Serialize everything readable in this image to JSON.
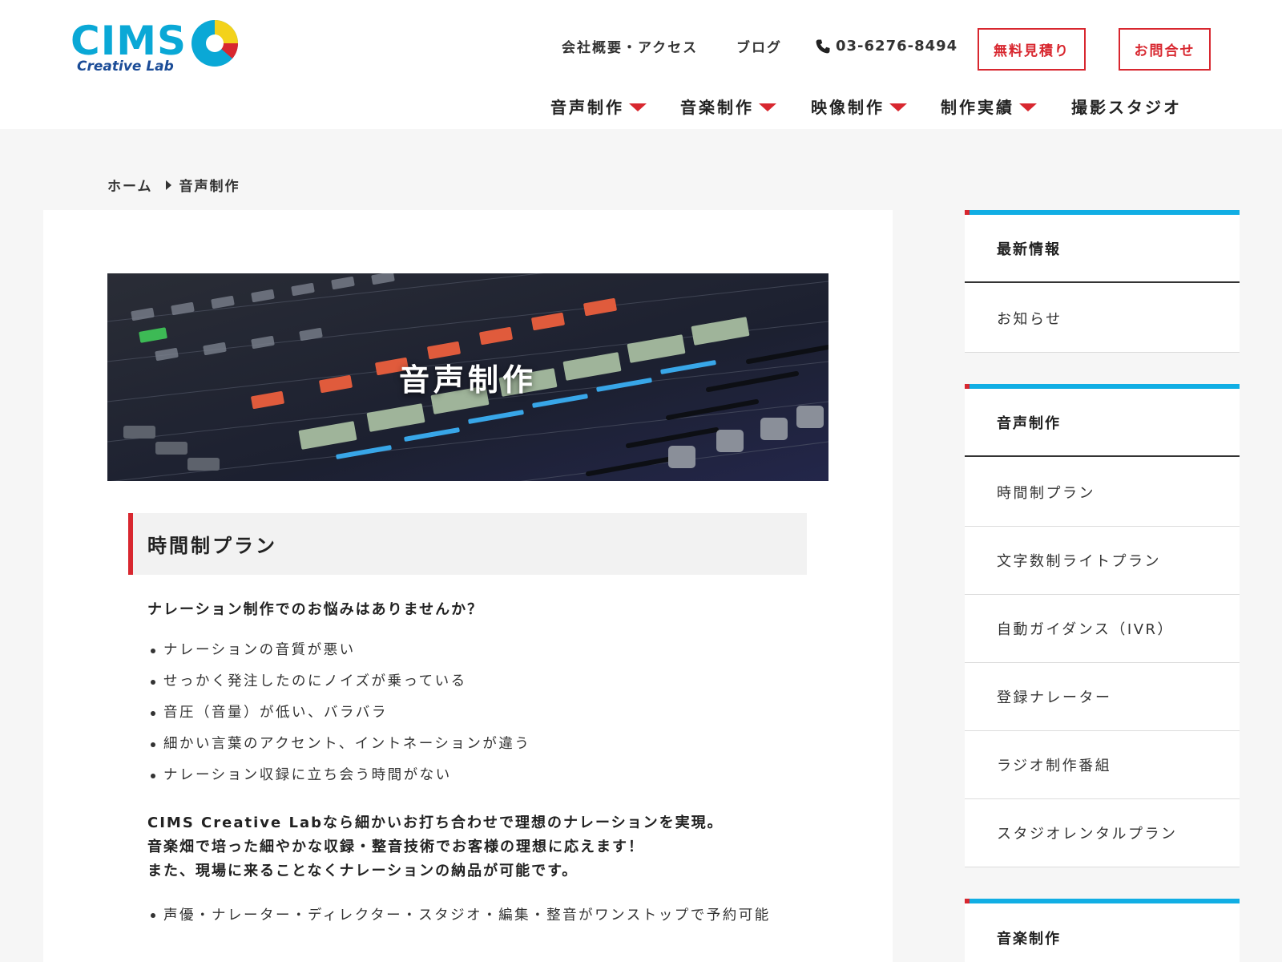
{
  "header": {
    "logo": {
      "main": "CIMS",
      "sub": "Creative Lab"
    },
    "utility_nav": {
      "company": "会社概要・アクセス",
      "blog": "ブログ",
      "phone": "03-6276-8494",
      "estimate_button": "無料見積り",
      "contact_button": "お問合せ"
    },
    "main_nav": [
      {
        "label": "音声制作",
        "has_dropdown": true
      },
      {
        "label": "音楽制作",
        "has_dropdown": true
      },
      {
        "label": "映像制作",
        "has_dropdown": true
      },
      {
        "label": "制作実績",
        "has_dropdown": true
      },
      {
        "label": "撮影スタジオ",
        "has_dropdown": false
      }
    ]
  },
  "breadcrumb": {
    "home": "ホーム",
    "current": "音声制作"
  },
  "main": {
    "hero_title": "音声制作",
    "section_title": "時間制プラン",
    "lead": "ナレーション制作でのお悩みはありませんか？",
    "concerns": [
      "ナレーションの音質が悪い",
      "せっかく発注したのにノイズが乗っている",
      "音圧（音量）が低い、バラバラ",
      "細かい言葉のアクセント、イントネーションが違う",
      "ナレーション収録に立ち会う時間がない"
    ],
    "paragraph": [
      "CIMS Creative Labなら細かいお打ち合わせで理想のナレーションを実現。",
      "音楽畑で培った細やかな収録・整音技術でお客様の理想に応えます！",
      "また、現場に来ることなくナレーションの納品が可能です。"
    ],
    "features": [
      "声優・ナレーター・ディレクター・スタジオ・編集・整音がワンストップで予約可能"
    ]
  },
  "sidebar": {
    "news": {
      "title": "最新情報",
      "items": [
        "お知らせ"
      ]
    },
    "voice": {
      "title": "音声制作",
      "items": [
        "時間制プラン",
        "文字数制ライトプラン",
        "自動ガイダンス（IVR）",
        "登録ナレーター",
        "ラジオ制作番組",
        "スタジオレンタルプラン"
      ]
    },
    "music": {
      "title": "音楽制作"
    }
  },
  "colors": {
    "accent_red": "#d8272f",
    "accent_blue": "#11aee4",
    "logo_blue": "#0aa8d6",
    "logo_navy": "#1b4c97",
    "logo_yellow": "#f3d21b"
  },
  "icons": [
    "phone-icon",
    "caret-down-icon",
    "breadcrumb-arrow-icon",
    "bullet-dot-icon"
  ]
}
